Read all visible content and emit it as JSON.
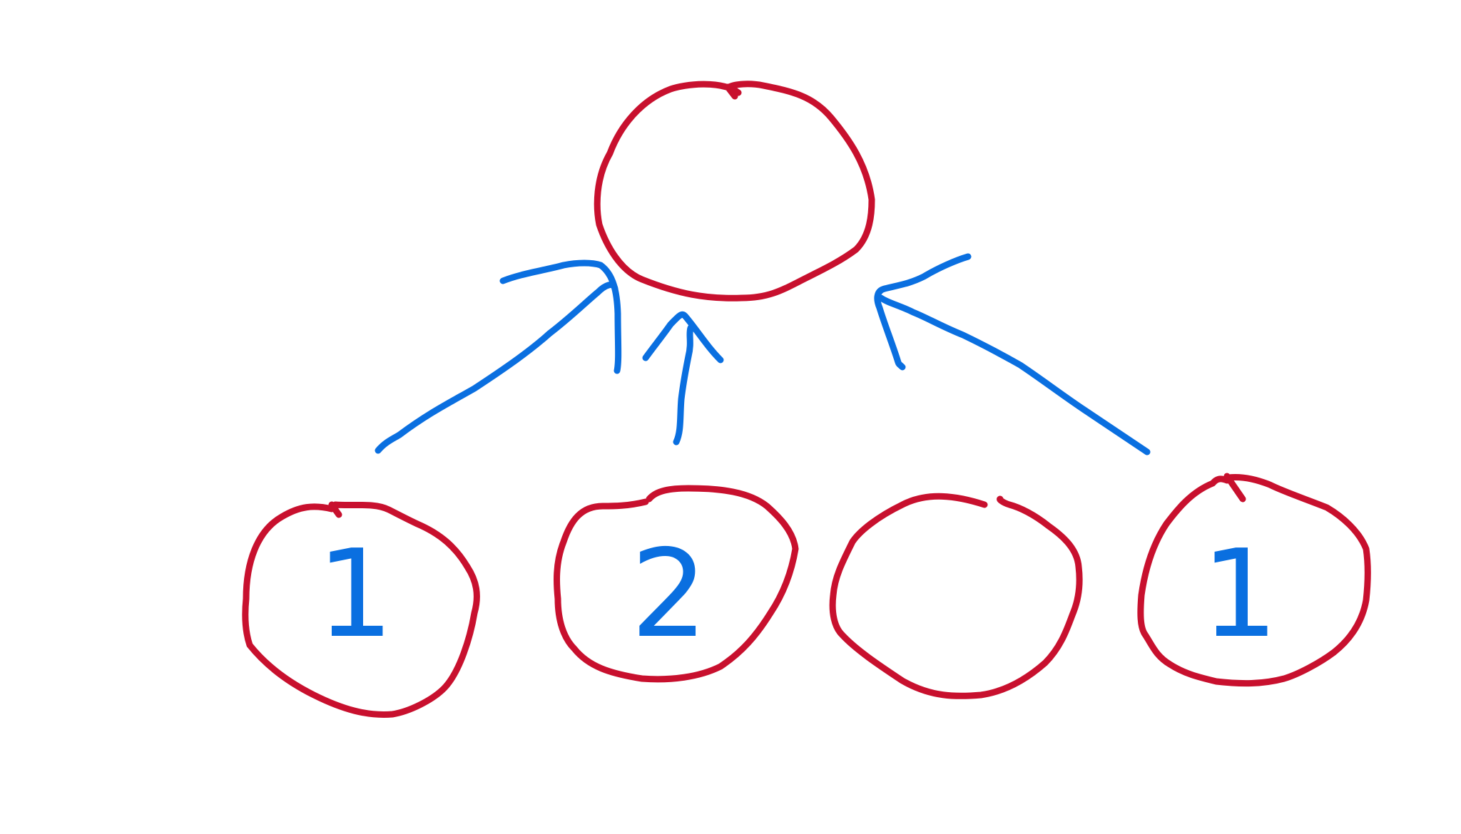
{
  "diagram": {
    "colors": {
      "node_outline": "#c8102e",
      "arrow": "#0a6fe0",
      "label": "#0a6fe0",
      "background": "#ffffff"
    },
    "nodes": [
      {
        "id": "root",
        "label": ""
      },
      {
        "id": "child-1",
        "label": "1"
      },
      {
        "id": "child-2",
        "label": "2"
      },
      {
        "id": "child-3",
        "label": ""
      },
      {
        "id": "child-4",
        "label": "1"
      }
    ],
    "edges": [
      {
        "from": "child-1",
        "to": "root"
      },
      {
        "from": "child-2",
        "to": "root"
      },
      {
        "from": "child-4",
        "to": "root"
      }
    ]
  }
}
